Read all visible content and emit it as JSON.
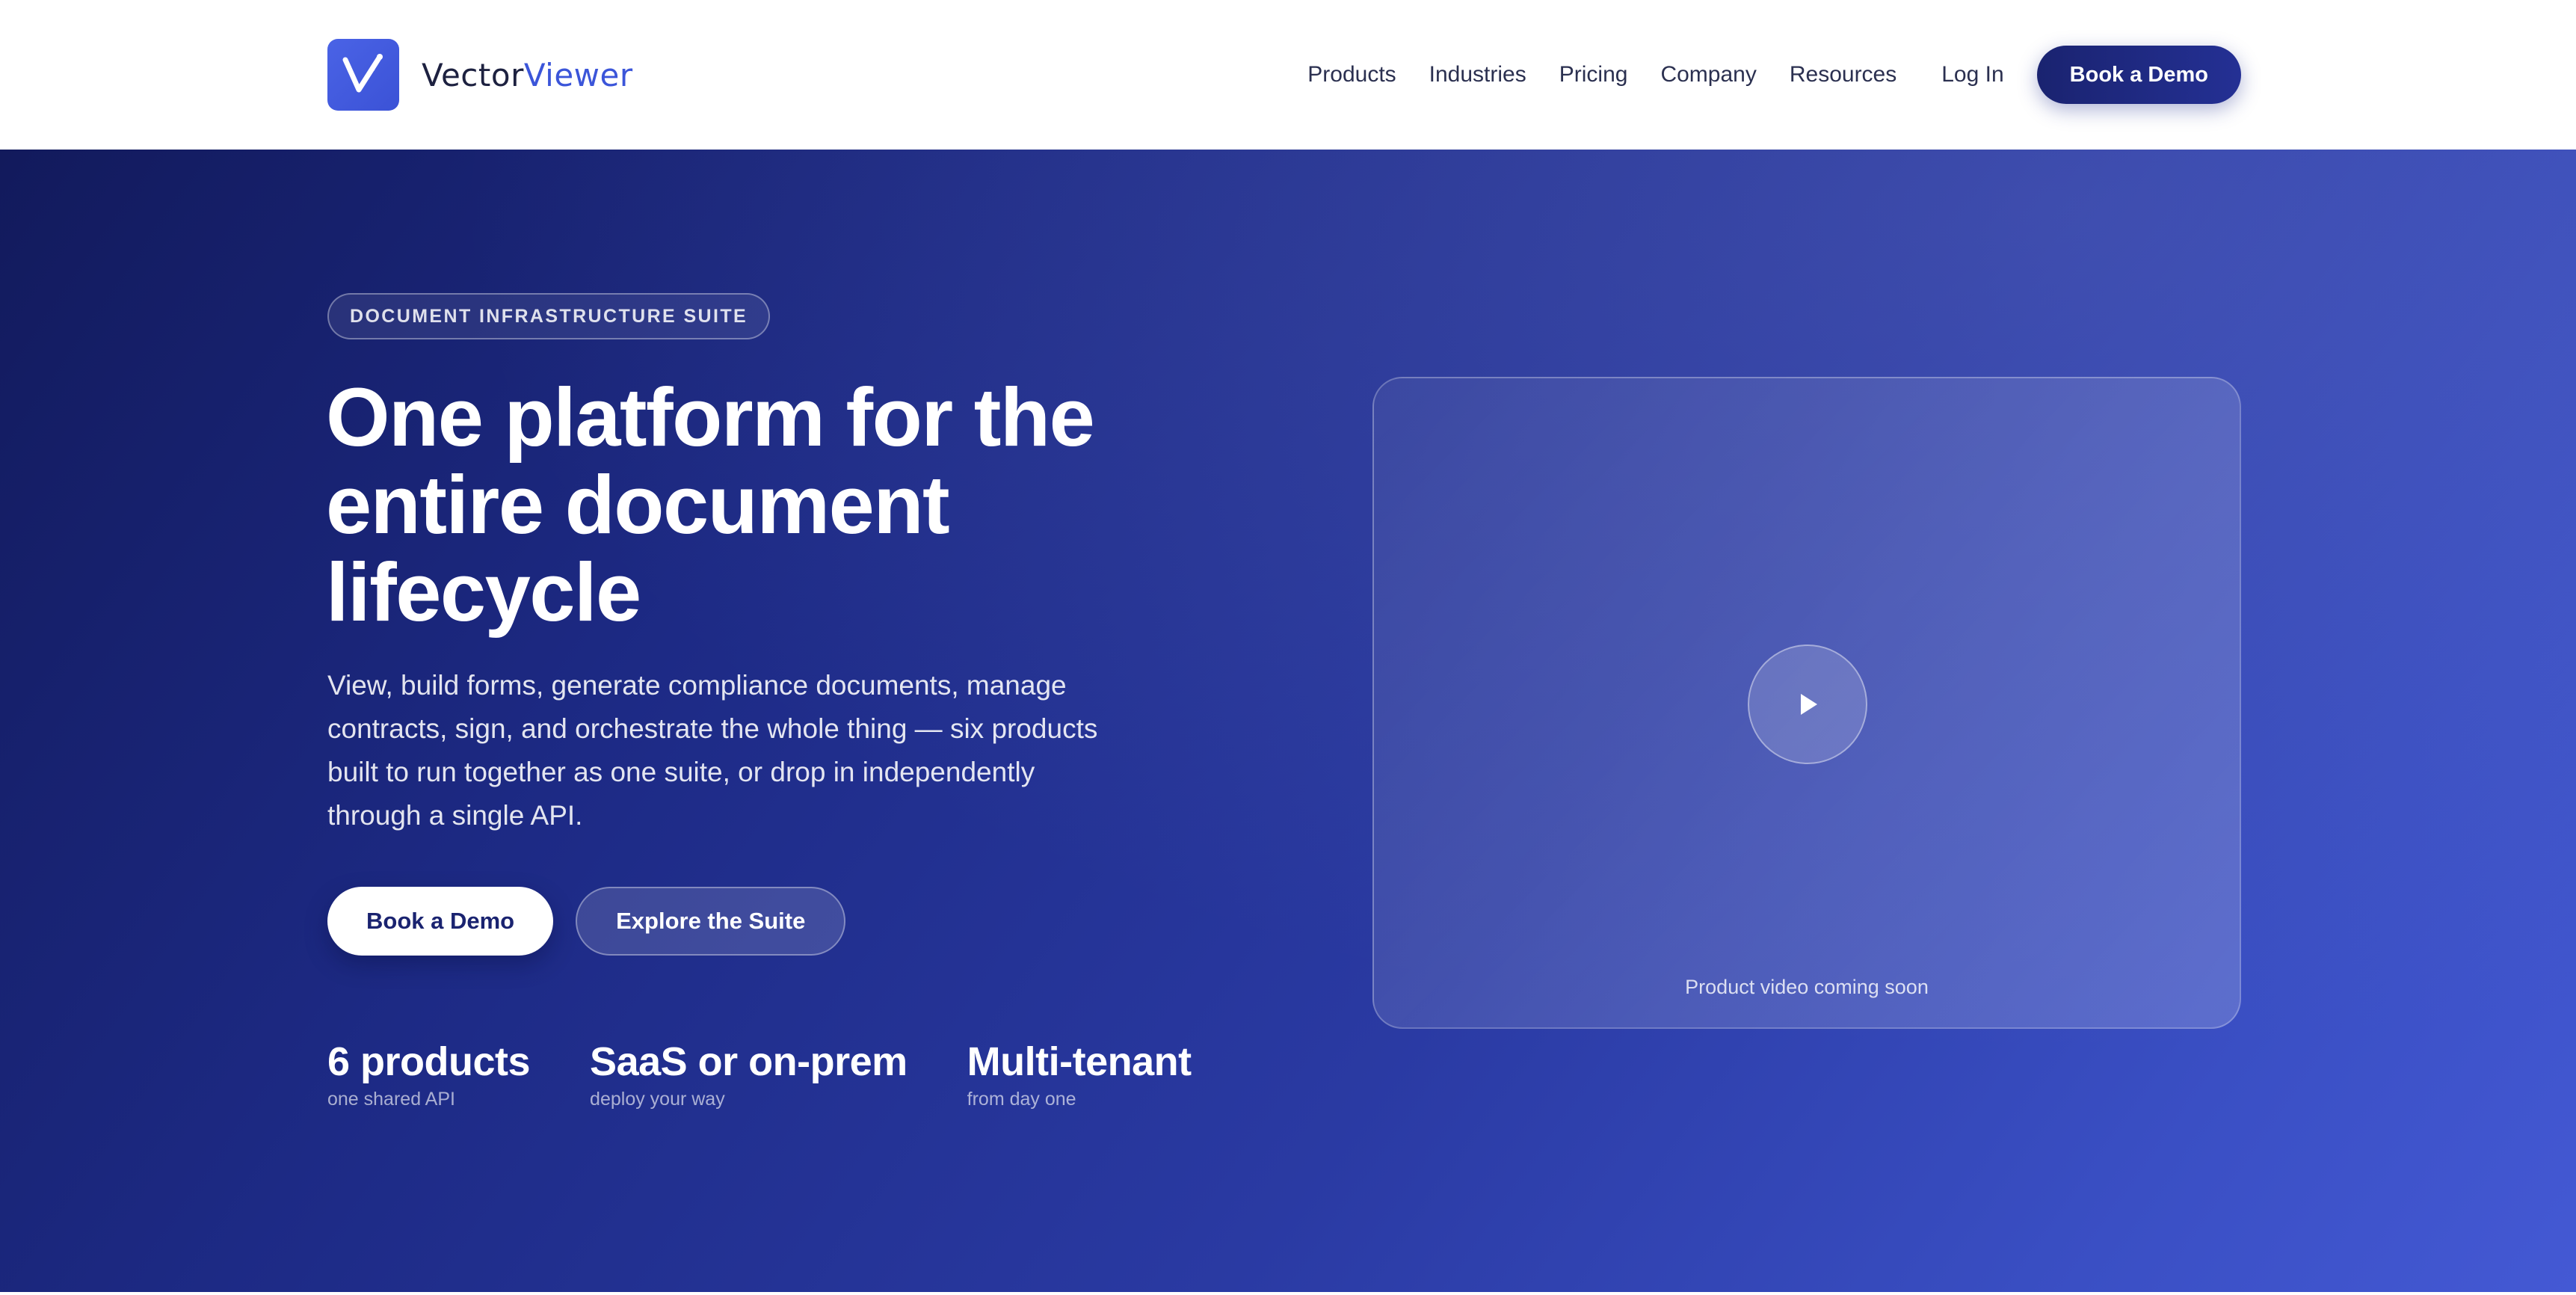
{
  "brand": {
    "name_part1": "Vector",
    "name_part2": "Viewer",
    "logo_icon": "checkmark-chart-icon",
    "accent_color": "#3b55d9"
  },
  "nav": {
    "items": [
      {
        "label": "Products"
      },
      {
        "label": "Industries"
      },
      {
        "label": "Pricing"
      },
      {
        "label": "Company"
      },
      {
        "label": "Resources"
      }
    ],
    "login_label": "Log In",
    "cta_label": "Book a Demo"
  },
  "hero": {
    "badge": "DOCUMENT INFRASTRUCTURE SUITE",
    "headline": "One platform for the entire document lifecycle",
    "subtext": "View, build forms, generate compliance documents, manage contracts, sign, and orchestrate the whole thing — six products built to run together as one suite, or drop in independently through a single API.",
    "primary_cta": "Book a Demo",
    "secondary_cta": "Explore the Suite",
    "stats": [
      {
        "value": "6 products",
        "label": "one shared API"
      },
      {
        "value": "SaaS or on-prem",
        "label": "deploy your way"
      },
      {
        "value": "Multi-tenant",
        "label": "from day one"
      }
    ],
    "video": {
      "play_icon": "play-icon",
      "caption": "Product video coming soon"
    },
    "gradient_start": "#121a5c",
    "gradient_end": "#4459d4"
  }
}
